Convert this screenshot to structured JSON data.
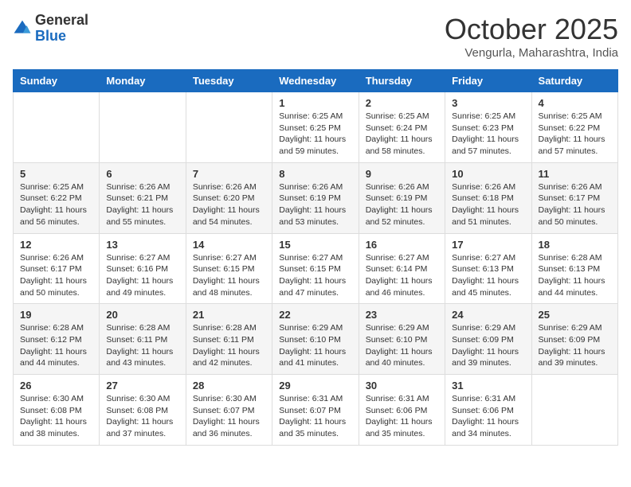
{
  "logo": {
    "general": "General",
    "blue": "Blue"
  },
  "title": "October 2025",
  "location": "Vengurla, Maharashtra, India",
  "days_of_week": [
    "Sunday",
    "Monday",
    "Tuesday",
    "Wednesday",
    "Thursday",
    "Friday",
    "Saturday"
  ],
  "weeks": [
    [
      {
        "day": "",
        "info": ""
      },
      {
        "day": "",
        "info": ""
      },
      {
        "day": "",
        "info": ""
      },
      {
        "day": "1",
        "info": "Sunrise: 6:25 AM\nSunset: 6:25 PM\nDaylight: 11 hours and 59 minutes."
      },
      {
        "day": "2",
        "info": "Sunrise: 6:25 AM\nSunset: 6:24 PM\nDaylight: 11 hours and 58 minutes."
      },
      {
        "day": "3",
        "info": "Sunrise: 6:25 AM\nSunset: 6:23 PM\nDaylight: 11 hours and 57 minutes."
      },
      {
        "day": "4",
        "info": "Sunrise: 6:25 AM\nSunset: 6:22 PM\nDaylight: 11 hours and 57 minutes."
      }
    ],
    [
      {
        "day": "5",
        "info": "Sunrise: 6:25 AM\nSunset: 6:22 PM\nDaylight: 11 hours and 56 minutes."
      },
      {
        "day": "6",
        "info": "Sunrise: 6:26 AM\nSunset: 6:21 PM\nDaylight: 11 hours and 55 minutes."
      },
      {
        "day": "7",
        "info": "Sunrise: 6:26 AM\nSunset: 6:20 PM\nDaylight: 11 hours and 54 minutes."
      },
      {
        "day": "8",
        "info": "Sunrise: 6:26 AM\nSunset: 6:19 PM\nDaylight: 11 hours and 53 minutes."
      },
      {
        "day": "9",
        "info": "Sunrise: 6:26 AM\nSunset: 6:19 PM\nDaylight: 11 hours and 52 minutes."
      },
      {
        "day": "10",
        "info": "Sunrise: 6:26 AM\nSunset: 6:18 PM\nDaylight: 11 hours and 51 minutes."
      },
      {
        "day": "11",
        "info": "Sunrise: 6:26 AM\nSunset: 6:17 PM\nDaylight: 11 hours and 50 minutes."
      }
    ],
    [
      {
        "day": "12",
        "info": "Sunrise: 6:26 AM\nSunset: 6:17 PM\nDaylight: 11 hours and 50 minutes."
      },
      {
        "day": "13",
        "info": "Sunrise: 6:27 AM\nSunset: 6:16 PM\nDaylight: 11 hours and 49 minutes."
      },
      {
        "day": "14",
        "info": "Sunrise: 6:27 AM\nSunset: 6:15 PM\nDaylight: 11 hours and 48 minutes."
      },
      {
        "day": "15",
        "info": "Sunrise: 6:27 AM\nSunset: 6:15 PM\nDaylight: 11 hours and 47 minutes."
      },
      {
        "day": "16",
        "info": "Sunrise: 6:27 AM\nSunset: 6:14 PM\nDaylight: 11 hours and 46 minutes."
      },
      {
        "day": "17",
        "info": "Sunrise: 6:27 AM\nSunset: 6:13 PM\nDaylight: 11 hours and 45 minutes."
      },
      {
        "day": "18",
        "info": "Sunrise: 6:28 AM\nSunset: 6:13 PM\nDaylight: 11 hours and 44 minutes."
      }
    ],
    [
      {
        "day": "19",
        "info": "Sunrise: 6:28 AM\nSunset: 6:12 PM\nDaylight: 11 hours and 44 minutes."
      },
      {
        "day": "20",
        "info": "Sunrise: 6:28 AM\nSunset: 6:11 PM\nDaylight: 11 hours and 43 minutes."
      },
      {
        "day": "21",
        "info": "Sunrise: 6:28 AM\nSunset: 6:11 PM\nDaylight: 11 hours and 42 minutes."
      },
      {
        "day": "22",
        "info": "Sunrise: 6:29 AM\nSunset: 6:10 PM\nDaylight: 11 hours and 41 minutes."
      },
      {
        "day": "23",
        "info": "Sunrise: 6:29 AM\nSunset: 6:10 PM\nDaylight: 11 hours and 40 minutes."
      },
      {
        "day": "24",
        "info": "Sunrise: 6:29 AM\nSunset: 6:09 PM\nDaylight: 11 hours and 39 minutes."
      },
      {
        "day": "25",
        "info": "Sunrise: 6:29 AM\nSunset: 6:09 PM\nDaylight: 11 hours and 39 minutes."
      }
    ],
    [
      {
        "day": "26",
        "info": "Sunrise: 6:30 AM\nSunset: 6:08 PM\nDaylight: 11 hours and 38 minutes."
      },
      {
        "day": "27",
        "info": "Sunrise: 6:30 AM\nSunset: 6:08 PM\nDaylight: 11 hours and 37 minutes."
      },
      {
        "day": "28",
        "info": "Sunrise: 6:30 AM\nSunset: 6:07 PM\nDaylight: 11 hours and 36 minutes."
      },
      {
        "day": "29",
        "info": "Sunrise: 6:31 AM\nSunset: 6:07 PM\nDaylight: 11 hours and 35 minutes."
      },
      {
        "day": "30",
        "info": "Sunrise: 6:31 AM\nSunset: 6:06 PM\nDaylight: 11 hours and 35 minutes."
      },
      {
        "day": "31",
        "info": "Sunrise: 6:31 AM\nSunset: 6:06 PM\nDaylight: 11 hours and 34 minutes."
      },
      {
        "day": "",
        "info": ""
      }
    ]
  ]
}
